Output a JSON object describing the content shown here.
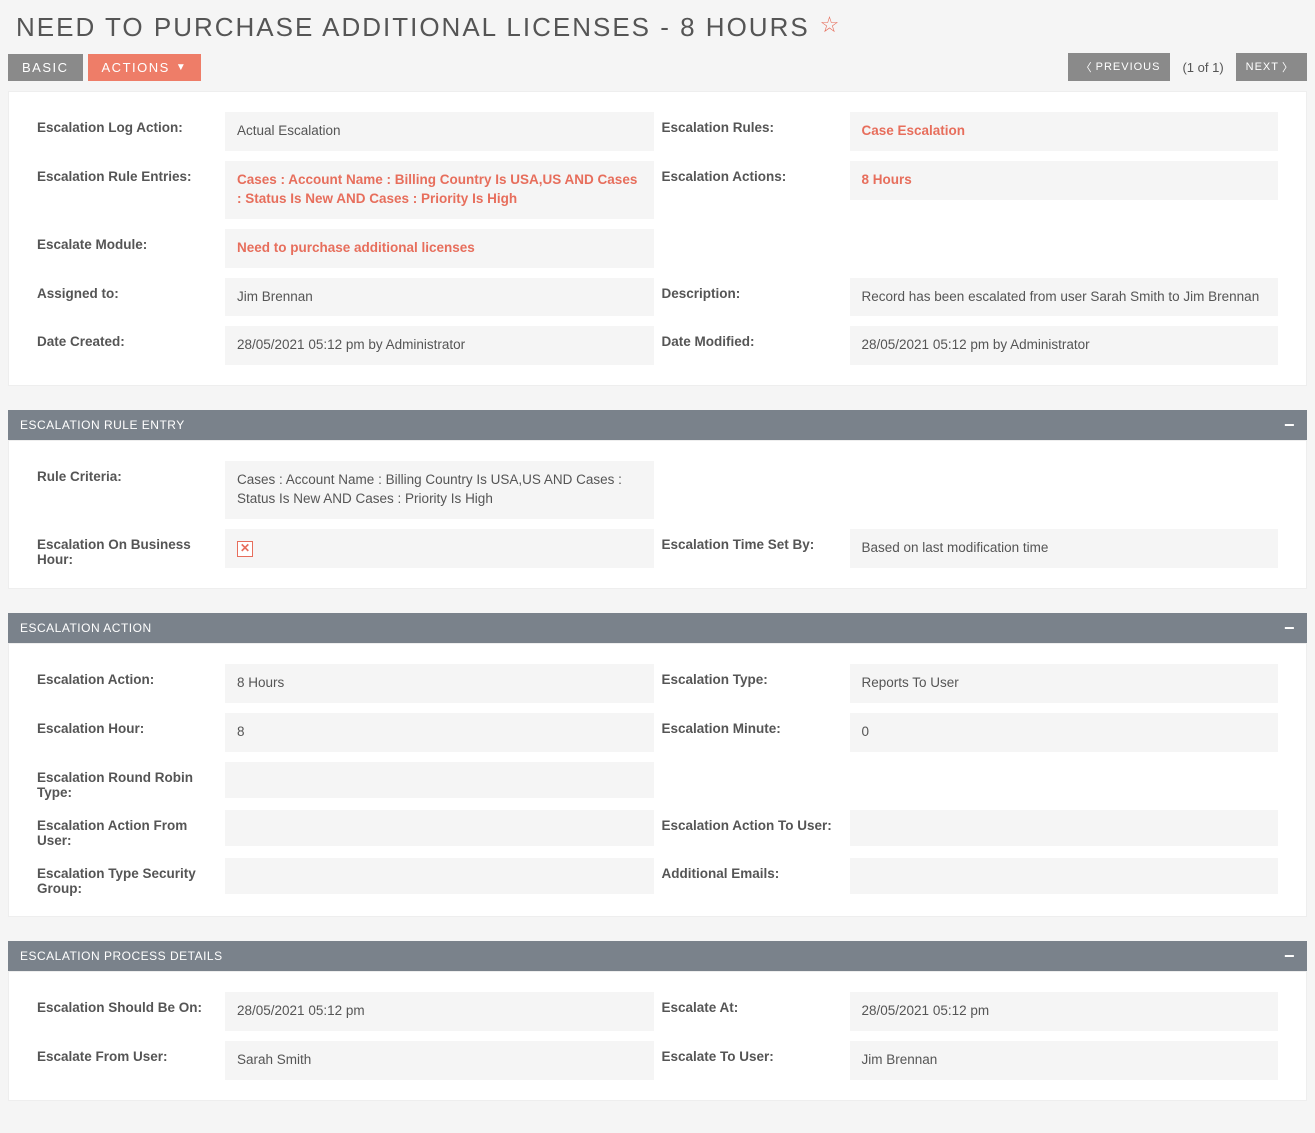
{
  "header": {
    "title": "NEED TO PURCHASE ADDITIONAL LICENSES - 8 HOURS"
  },
  "toolbar": {
    "basic": "BASIC",
    "actions": "ACTIONS",
    "previous": "PREVIOUS",
    "next": "NEXT",
    "page_count": "(1 of 1)"
  },
  "main": {
    "labels": {
      "escalation_log_action": "Escalation Log Action:",
      "escalation_rules": "Escalation Rules:",
      "escalation_rule_entries": "Escalation Rule Entries:",
      "escalation_actions": "Escalation Actions:",
      "escalate_module": "Escalate Module:",
      "assigned_to": "Assigned to:",
      "description": "Description:",
      "date_created": "Date Created:",
      "date_modified": "Date Modified:"
    },
    "values": {
      "escalation_log_action": "Actual Escalation",
      "escalation_rules": "Case Escalation",
      "escalation_rule_entries": "Cases : Account Name : Billing Country Is USA,US AND Cases : Status Is New AND Cases : Priority Is High",
      "escalation_actions": "8 Hours",
      "escalate_module": "Need to purchase additional licenses",
      "assigned_to": "Jim Brennan",
      "description": "Record has been escalated from user Sarah Smith to Jim Brennan",
      "date_created": "28/05/2021 05:12 pm by Administrator",
      "date_modified": "28/05/2021 05:12 pm by Administrator"
    }
  },
  "sections": {
    "rule_entry": {
      "title": "ESCALATION RULE ENTRY",
      "labels": {
        "rule_criteria": "Rule Criteria:",
        "escalation_on_business_hour": "Escalation On Business Hour:",
        "escalation_time_set_by": "Escalation Time Set By:"
      },
      "values": {
        "rule_criteria": "Cases : Account Name : Billing Country Is USA,US AND Cases : Status Is New AND Cases : Priority Is High",
        "escalation_time_set_by": "Based on last modification time"
      }
    },
    "action": {
      "title": "ESCALATION ACTION",
      "labels": {
        "escalation_action": "Escalation Action:",
        "escalation_type": "Escalation Type:",
        "escalation_hour": "Escalation Hour:",
        "escalation_minute": "Escalation Minute:",
        "escalation_round_robin_type": "Escalation Round Robin Type:",
        "escalation_action_from_user": "Escalation Action From User:",
        "escalation_action_to_user": "Escalation Action To User:",
        "escalation_type_security_group": "Escalation Type Security Group:",
        "additional_emails": "Additional Emails:"
      },
      "values": {
        "escalation_action": "8 Hours",
        "escalation_type": "Reports To User",
        "escalation_hour": "8",
        "escalation_minute": "0",
        "escalation_round_robin_type": "",
        "escalation_action_from_user": "",
        "escalation_action_to_user": "",
        "escalation_type_security_group": "",
        "additional_emails": ""
      }
    },
    "process": {
      "title": "ESCALATION PROCESS DETAILS",
      "labels": {
        "escalation_should_be_on": "Escalation Should Be On:",
        "escalate_at": "Escalate At:",
        "escalate_from_user": "Escalate From User:",
        "escalate_to_user": "Escalate To User:"
      },
      "values": {
        "escalation_should_be_on": "28/05/2021 05:12 pm",
        "escalate_at": "28/05/2021 05:12 pm",
        "escalate_from_user": "Sarah Smith",
        "escalate_to_user": "Jim Brennan"
      }
    }
  }
}
